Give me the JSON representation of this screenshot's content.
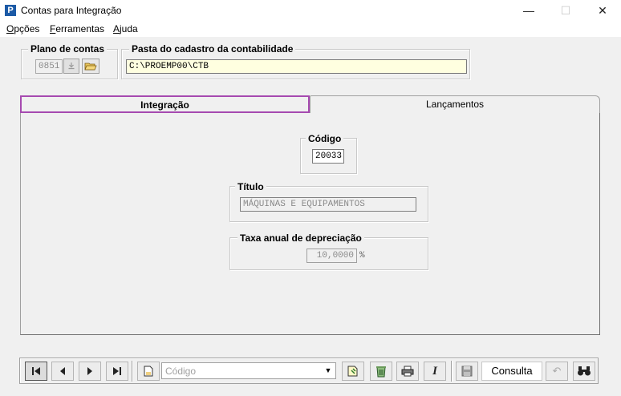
{
  "window": {
    "app_icon": "P",
    "title": "Contas para Integração",
    "minimize": "—",
    "maximize": "☐",
    "close": "✕"
  },
  "menu": [
    {
      "label": "Opções",
      "accel": "O",
      "rest": "pções"
    },
    {
      "label": "Ferramentas",
      "accel": "F",
      "rest": "erramentas"
    },
    {
      "label": "Ajuda",
      "accel": "A",
      "rest": "juda"
    }
  ],
  "plano_contas": {
    "legend": "Plano de contas",
    "value": "0851"
  },
  "pasta": {
    "legend": "Pasta do cadastro da contabilidade",
    "value": "C:\\PROEMP00\\CTB"
  },
  "tabs": [
    {
      "label": "Integração",
      "active": true
    },
    {
      "label": "Lançamentos",
      "active": false
    }
  ],
  "codigo": {
    "legend": "Código",
    "value": "20033"
  },
  "titulo": {
    "legend": "Título",
    "value": "MÁQUINAS E EQUIPAMENTOS"
  },
  "taxa": {
    "legend": "Taxa anual de depreciação",
    "value": "10,0000",
    "unit": "%"
  },
  "toolbar": {
    "search_placeholder": "Código",
    "mode_label": "Consulta"
  },
  "colors": {
    "active_tab_border": "#a64ab0",
    "yellow_field": "#ffffe0",
    "app_icon_bg": "#1c5aa6"
  }
}
